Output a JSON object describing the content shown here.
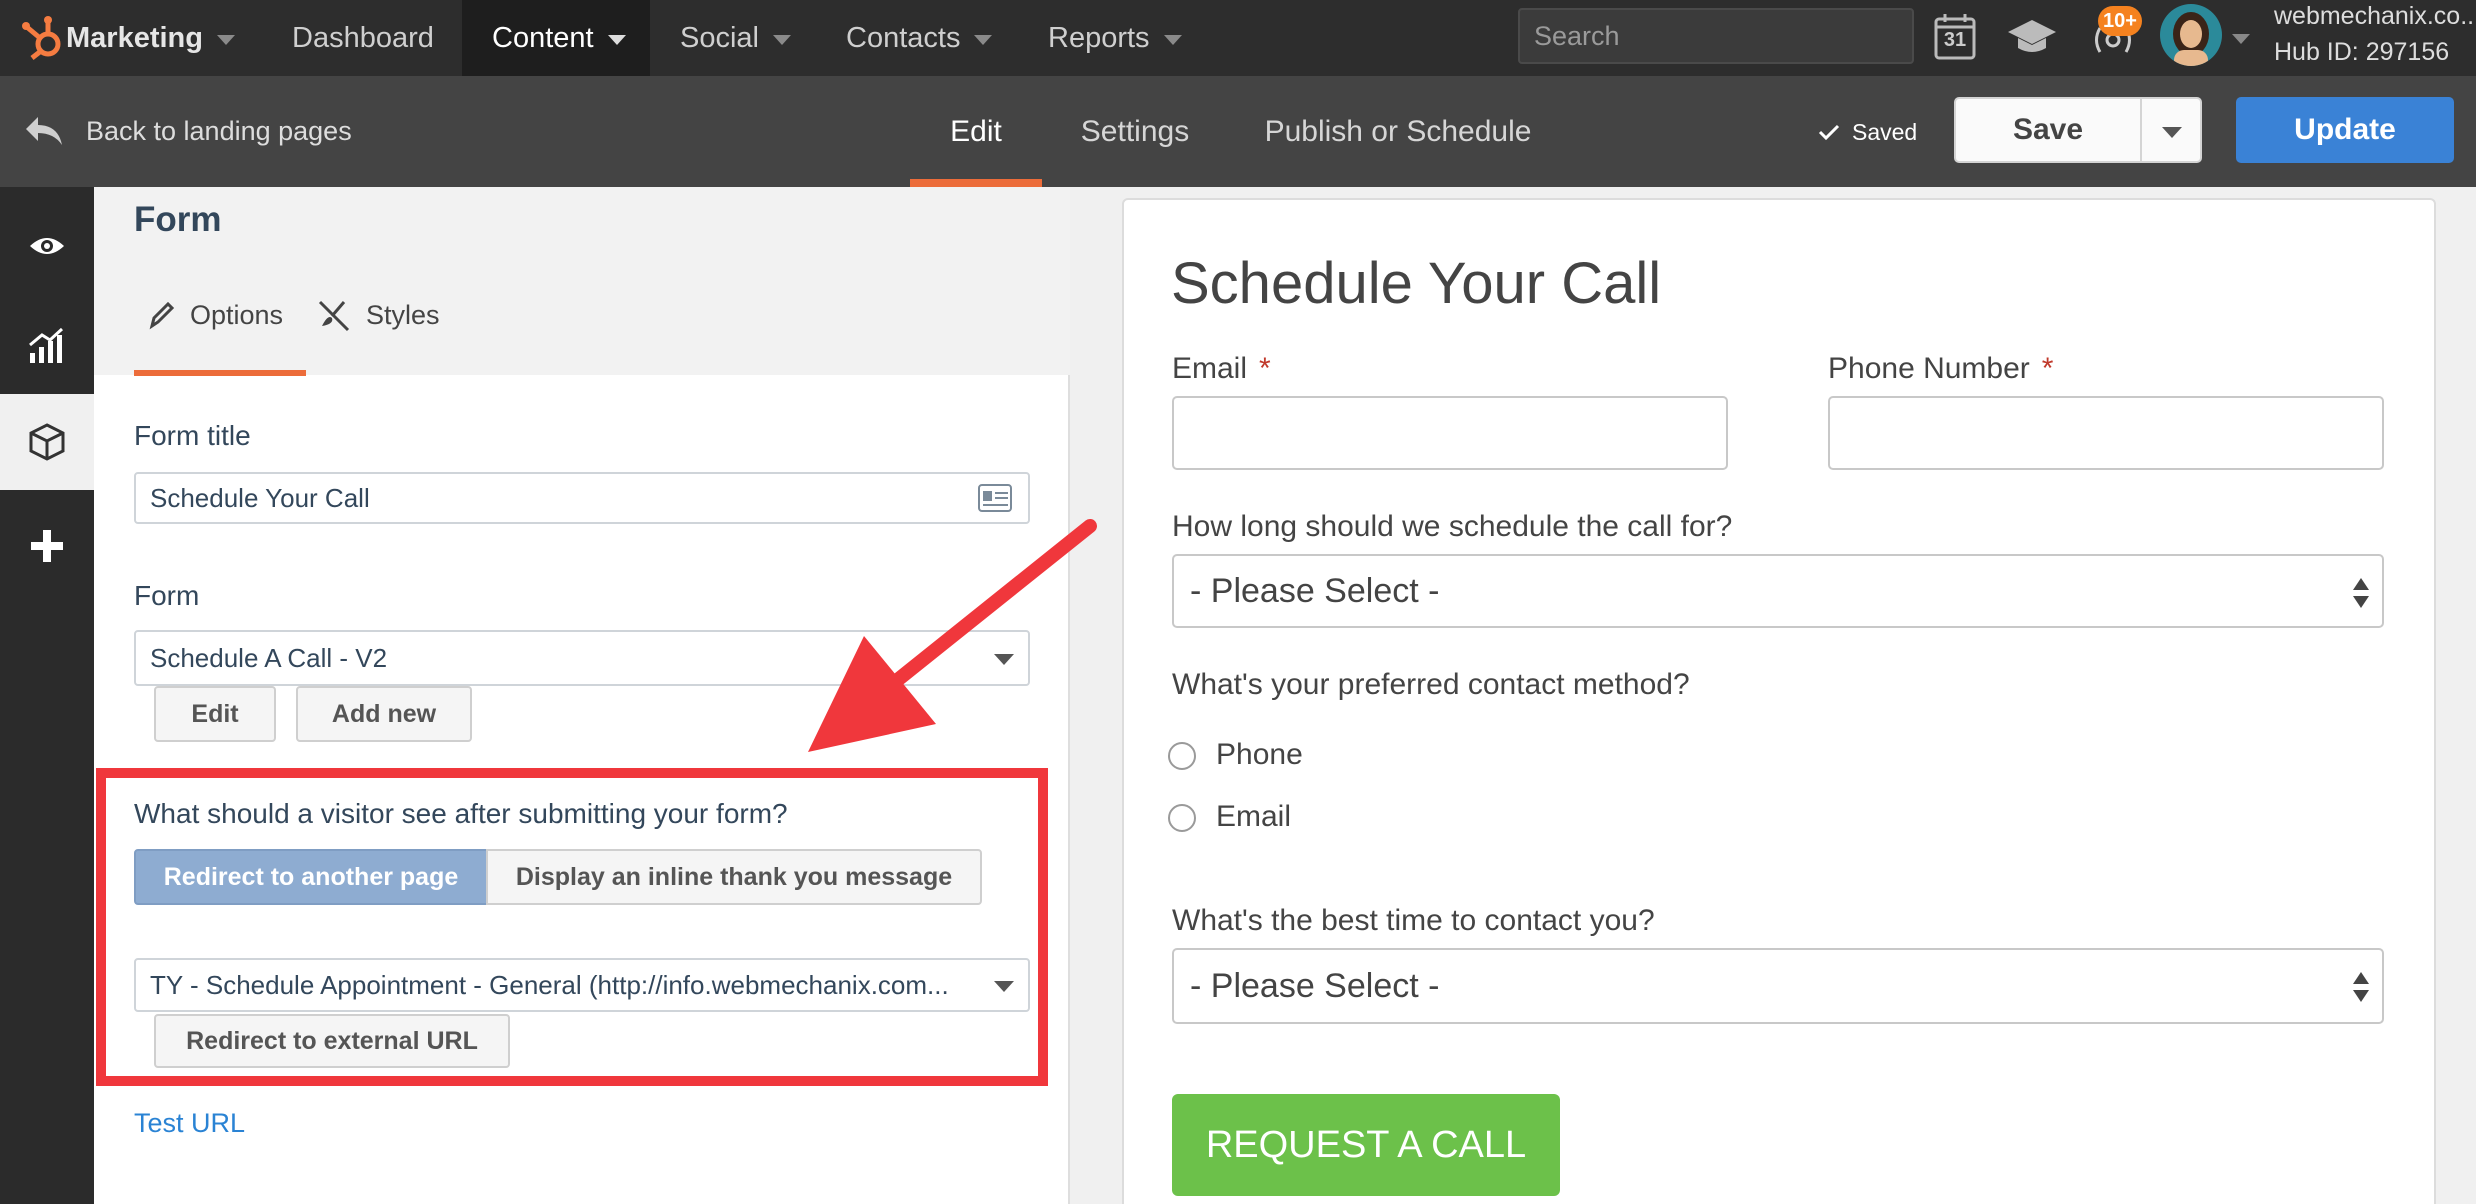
{
  "topnav": {
    "brand": "Marketing",
    "items": [
      "Dashboard",
      "Content",
      "Social",
      "Contacts",
      "Reports"
    ],
    "search_placeholder": "Search",
    "calendar_day": "31",
    "notification_count": "10+",
    "account_domain": "webmechanix.co...",
    "hub_id": "Hub ID: 297156"
  },
  "subheader": {
    "back_label": "Back to landing pages",
    "tabs": [
      "Edit",
      "Settings",
      "Publish or Schedule"
    ],
    "saved_label": "Saved",
    "save_label": "Save",
    "update_label": "Update"
  },
  "panel": {
    "title": "Form",
    "tabs": [
      "Options",
      "Styles"
    ],
    "form_title_label": "Form title",
    "form_title_value": "Schedule Your Call",
    "form_label": "Form",
    "form_value": "Schedule A Call - V2",
    "edit_label": "Edit",
    "add_new_label": "Add new",
    "after_submit_question": "What should a visitor see after submitting your form?",
    "redirect_option": "Redirect to another page",
    "inline_option": "Display an inline thank you message",
    "redirect_page_value": "TY - Schedule Appointment - General (http://info.webmechanix.com...",
    "external_url_label": "Redirect to external URL",
    "test_url_label": "Test URL"
  },
  "preview": {
    "heading": "Schedule Your Call",
    "email_label": "Email",
    "phone_label": "Phone Number",
    "required_mark": "*",
    "duration_label": "How long should we schedule the call for?",
    "select_placeholder": "- Please Select -",
    "contact_method_label": "What's your preferred contact method?",
    "contact_options": [
      "Phone",
      "Email"
    ],
    "best_time_label": "What's the best time to contact you?",
    "submit_label": "REQUEST A CALL"
  },
  "colors": {
    "accent_orange": "#ec6c3a",
    "update_blue": "#3a82d6",
    "submit_green": "#6cc14a",
    "highlight_red": "#f0373c",
    "redirect_selected": "#8eacd1"
  }
}
